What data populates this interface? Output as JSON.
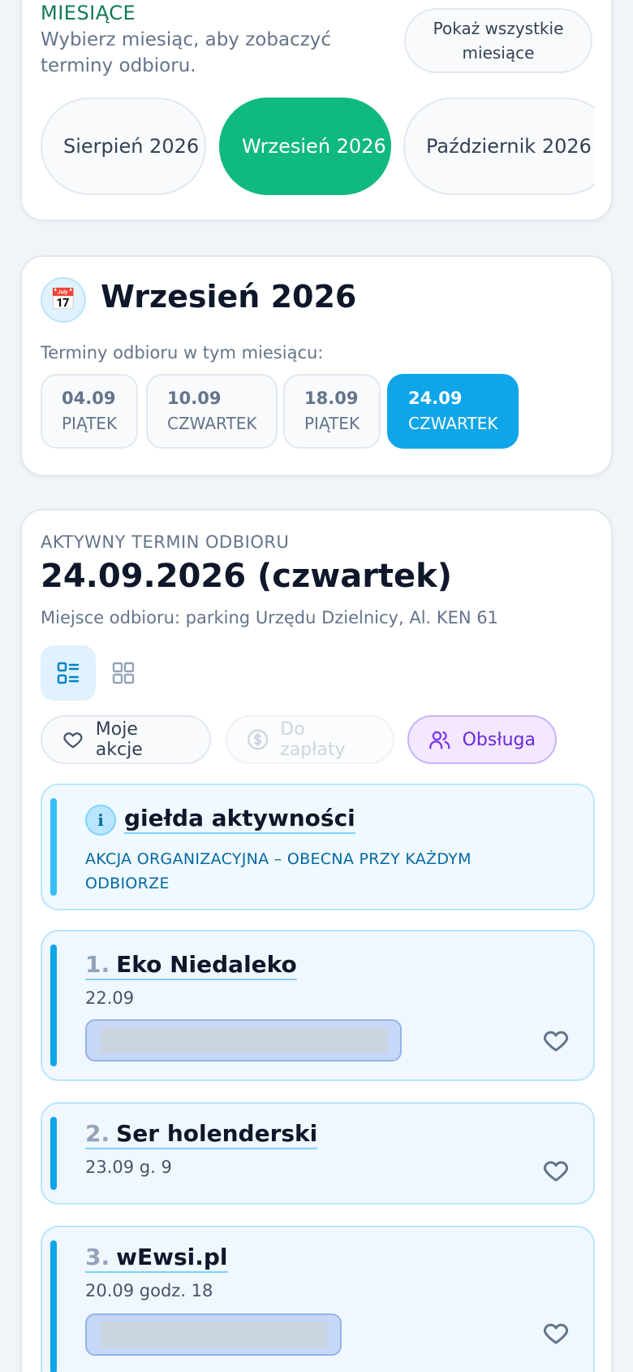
{
  "months": {
    "title": "MIESIĄCE",
    "subtitle": "Wybierz miesiąc, aby zobaczyć terminy odbioru.",
    "show_all_label": "Pokaż wszystkie miesiące",
    "items": [
      {
        "label": "Sierpień 2026",
        "active": false
      },
      {
        "label": "Wrzesień 2026",
        "active": true
      },
      {
        "label": "Październik 2026",
        "active": false
      }
    ]
  },
  "month_detail": {
    "icon": "calendar-icon",
    "title": "Wrzesień 2026",
    "dates_label": "Terminy odbioru w tym miesiącu:",
    "dates": [
      {
        "date": "04.09",
        "weekday": "PIĄTEK",
        "active": false
      },
      {
        "date": "10.09",
        "weekday": "CZWARTEK",
        "active": false
      },
      {
        "date": "18.09",
        "weekday": "PIĄTEK",
        "active": false
      },
      {
        "date": "24.09",
        "weekday": "CZWARTEK",
        "active": true
      }
    ]
  },
  "term": {
    "label": "AKTYWNY TERMIN ODBIORU",
    "date": "24.09.2026 (czwartek)",
    "place": "Miejsce odbioru: parking Urzędu Dzielnicy, Al. KEN 61",
    "views": [
      "list-view-icon",
      "grid-view-icon"
    ],
    "filters": {
      "my_actions": "Moje akcje",
      "to_pay": "Do zapłaty",
      "staff": "Obsługa"
    },
    "info_item": {
      "title": "giełda aktywności",
      "subtitle": "AKCJA ORGANIZACYJNA – OBECNA PRZY KAŻDYM ODBIORZE"
    },
    "items": [
      {
        "num": "1.",
        "title": "Eko Niedaleko",
        "note": "22.09"
      },
      {
        "num": "2.",
        "title": "Ser holenderski",
        "note": "23.09 g. 9"
      },
      {
        "num": "3.",
        "title": "wEwsi.pl",
        "note": "20.09 godz. 18"
      }
    ]
  },
  "colors": {
    "accent_green": "#10b981",
    "accent_blue": "#0ea5e9",
    "staff_purple": "#6d28d9"
  }
}
